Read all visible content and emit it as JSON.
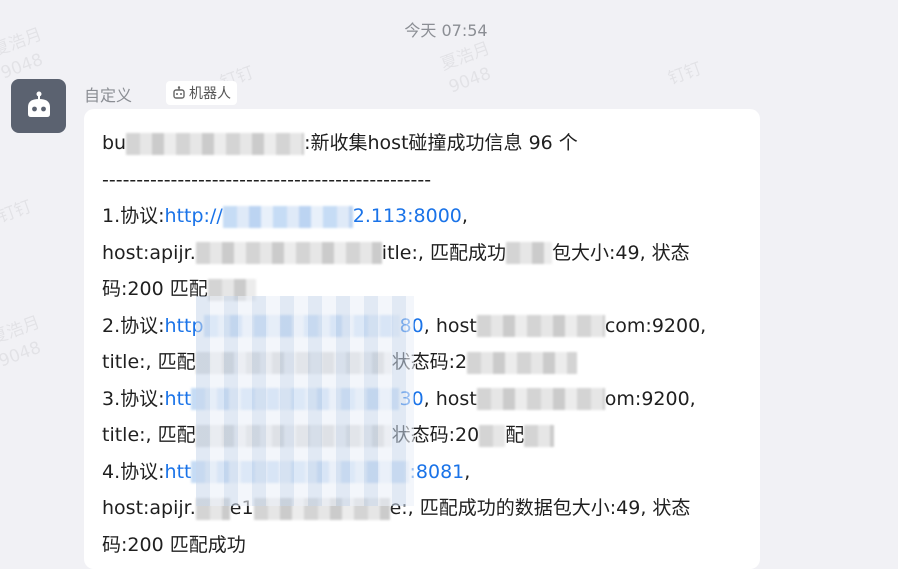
{
  "header": {
    "timestamp": "今天 07:54"
  },
  "watermarks": [
    "夏浩月\n9048",
    "钉钉",
    "夏浩月\n9048",
    "钉钉",
    "夏浩月\n9048",
    "钉钉"
  ],
  "sender": {
    "name": "自定义",
    "tag_label": "机器人",
    "avatar_icon": "robot-icon",
    "tag_icon": "robot-icon"
  },
  "message": {
    "title_prefix": "bu",
    "title_suffix": ":新收集host碰撞成功信息 96 个",
    "separator": "------------------------------------------------",
    "lines": [
      {
        "a": "1.协议:",
        "link": "http://",
        "b": "",
        "link2": "2.113:8000",
        "c": ","
      },
      {
        "a": "host:apijr.",
        "b": "itle:, 匹配成功",
        "c": "包大小:49, 状态"
      },
      {
        "a": "码:200 匹配"
      },
      {
        "a": "2.协议:",
        "link": "http",
        "link2": "80",
        "b": ", host",
        "c": "com:9200,"
      },
      {
        "a": "title:, 匹配",
        "b": "状态码:2"
      },
      {
        "a": "3.协议:",
        "link": "htt",
        "link2": "30",
        "b": ", host",
        "c": "om:9200,"
      },
      {
        "a": "title:, 匹配",
        "b": "状态码:20",
        "c": "配"
      },
      {
        "a": "4.协议:",
        "link": "htt",
        "link2": ":8081",
        "c": ","
      },
      {
        "a": "host:apijr.",
        "b": "e1",
        "c": "e:, 匹配成功的数据包大小:49, 状态"
      },
      {
        "a": "码:200 匹配成功"
      }
    ]
  }
}
